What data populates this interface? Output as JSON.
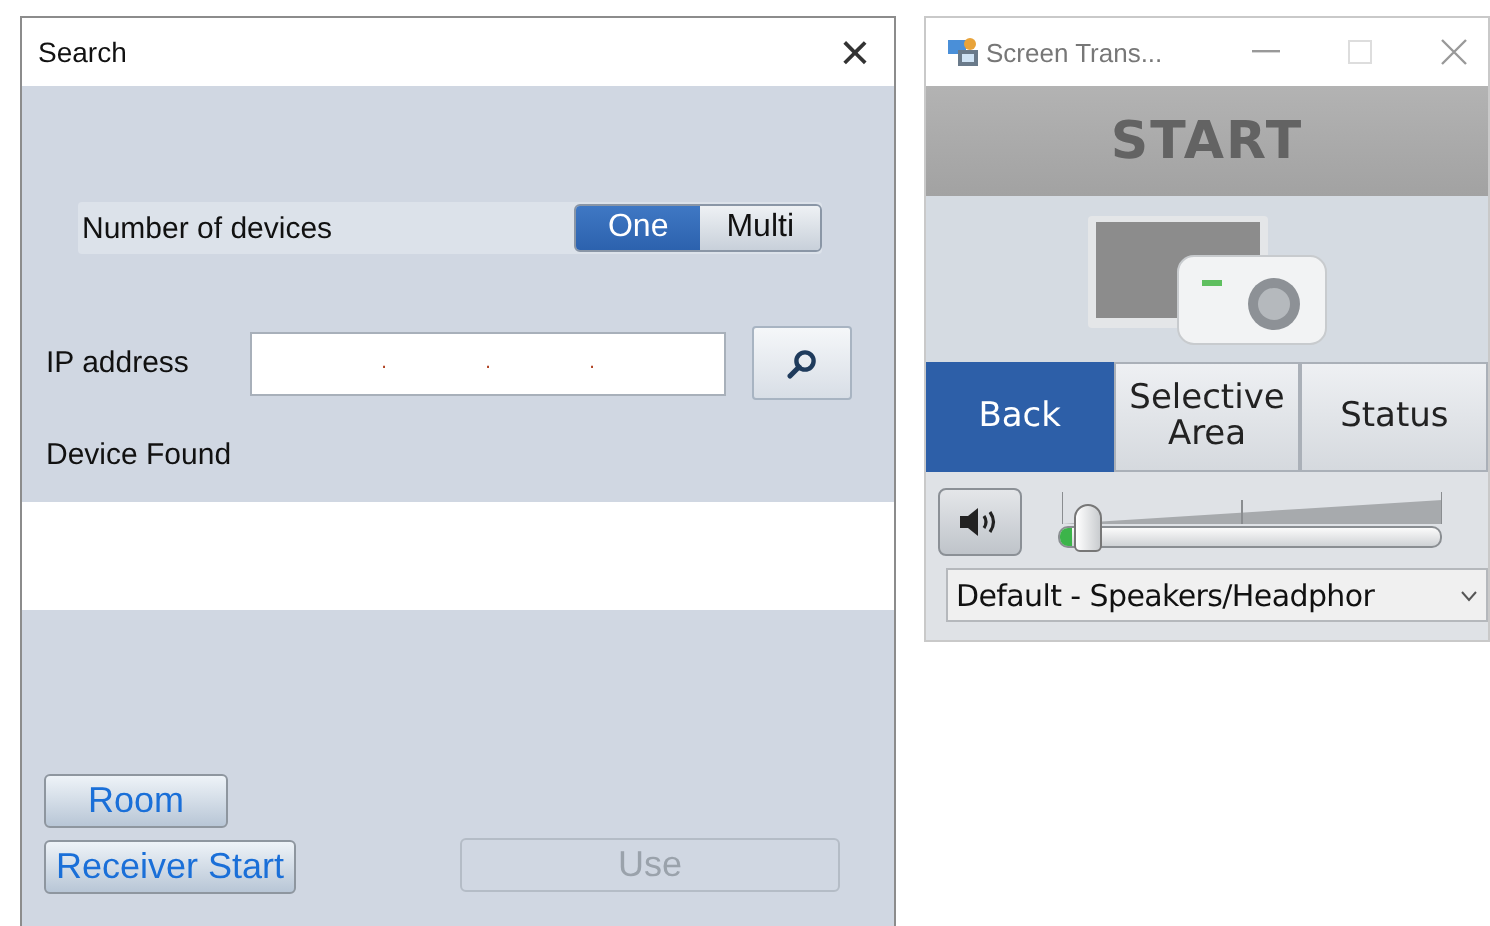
{
  "search_window": {
    "title": "Search",
    "close": "×",
    "number_of_devices": {
      "label": "Number of devices",
      "options": [
        {
          "label": "One",
          "selected": true
        },
        {
          "label": "Multi",
          "selected": false
        }
      ]
    },
    "ip_address": {
      "label": "IP address",
      "separators": [
        ".",
        ".",
        "."
      ]
    },
    "device_found": {
      "label": "Device Found"
    },
    "buttons": [
      {
        "label": "Room",
        "disabled": false,
        "kind": "left"
      },
      {
        "label": "Receiver Start",
        "disabled": false,
        "kind": "left"
      },
      {
        "label": "Use",
        "disabled": true,
        "kind": "right"
      }
    ]
  },
  "transfer_window": {
    "title": "Screen Trans...",
    "start": "START",
    "tabs": [
      {
        "label": "Back",
        "selected": true
      },
      {
        "label": "Selective Area",
        "selected": false
      },
      {
        "label": "Status",
        "selected": false
      }
    ],
    "volume": {
      "level": 0.03
    },
    "device": {
      "value": "Default - Speakers/Headphor"
    }
  }
}
